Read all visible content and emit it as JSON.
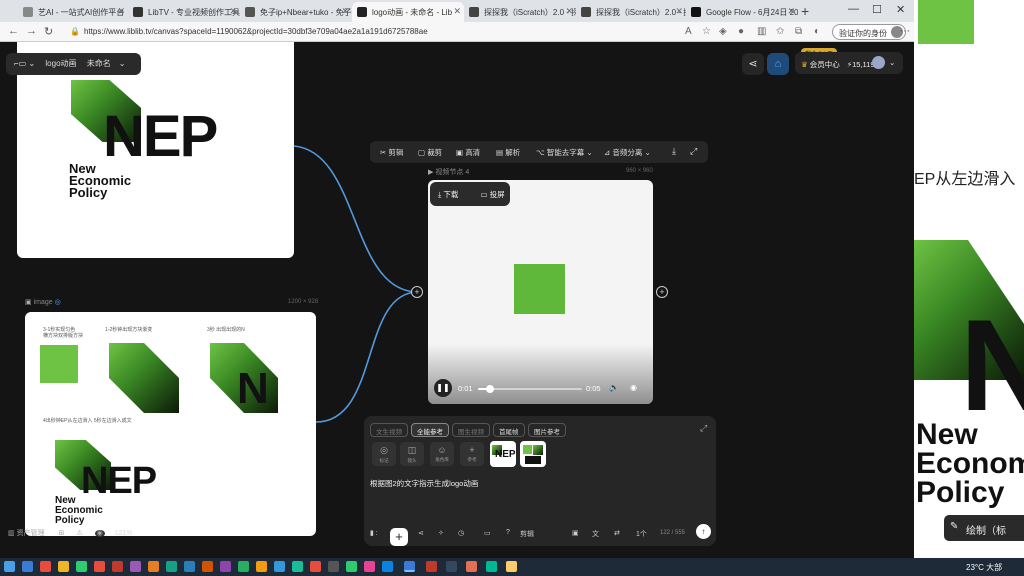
{
  "tabs": [
    {
      "label": "艺AI - 一站式AI创作平台",
      "icon_color": "#777"
    },
    {
      "label": "LibTV - 专业视频创作工具",
      "icon_color": "#333"
    },
    {
      "label": "免子ip+Nbear+tuko - 免子ip",
      "icon_color": "#555"
    },
    {
      "label": "logo动画 - 未命名 - Lib",
      "icon_color": "#222"
    },
    {
      "label": "探探我（iScratch）2.0 - 探探",
      "icon_color": "#444"
    },
    {
      "label": "探探我（iScratch）2.0 - 探探",
      "icon_color": "#444"
    },
    {
      "label": "Google Flow - 6月24日 20:16",
      "icon_color": "#111"
    }
  ],
  "address": {
    "url": "https://www.liblib.tv/canvas?spaceId=1190062&projectId=30dbf3e709a04ae2a1a191d6725788ae",
    "profile_label": "验证你的身份"
  },
  "app": {
    "project_group": "logo动画",
    "project_name": "未命名",
    "days_badge": "剩余 34 天",
    "member_label": "会员中心",
    "credits": "15,119"
  },
  "canvas": {
    "image_node_label": "image",
    "image_node_dims": "1200 × 928",
    "video_node_label": "视频节点 4",
    "video_node_dims": "960 × 960",
    "logo": {
      "initials": "NEP",
      "line1": "New",
      "line2": "Economic",
      "line3": "Policy"
    },
    "annotations": {
      "a1": "3-1秒实现匀色",
      "a1b": "横方块双排版方块",
      "a2": "1-2秒钟出现方块渐变",
      "a3": "3秒 出现出现的N",
      "a4": "4出秒钟EP从左边滑入 5秒左边滑入成文"
    }
  },
  "toolbar": {
    "items": [
      "剪辑",
      "裁剪",
      "高清",
      "解析",
      "智能去字幕",
      "音频分离"
    ]
  },
  "video": {
    "download": "下载",
    "cast": "投屏",
    "current_time": "0:01",
    "duration": "0:05",
    "progress": 0.12
  },
  "prompt": {
    "modes": [
      "文生视频",
      "全能参考",
      "图生视频",
      "首尾帧",
      "图片参考"
    ],
    "active_mode": "全能参考",
    "tools": [
      "标记",
      "镜头",
      "角色库",
      "参考"
    ],
    "text": "根据图2的文字指示生成logo动画",
    "model_label": "剪辑",
    "count": "1个",
    "char_count": "122 / 555"
  },
  "bottom_left": {
    "assets": "资产管理",
    "zoom": "121%"
  },
  "right_window": {
    "text": "EP从左边滑入",
    "logo_letter": "N",
    "words": [
      "New",
      "Economic",
      "Policy"
    ],
    "draw_label": "绘制（标"
  },
  "taskbar": {
    "weather": "23°C 大部"
  }
}
